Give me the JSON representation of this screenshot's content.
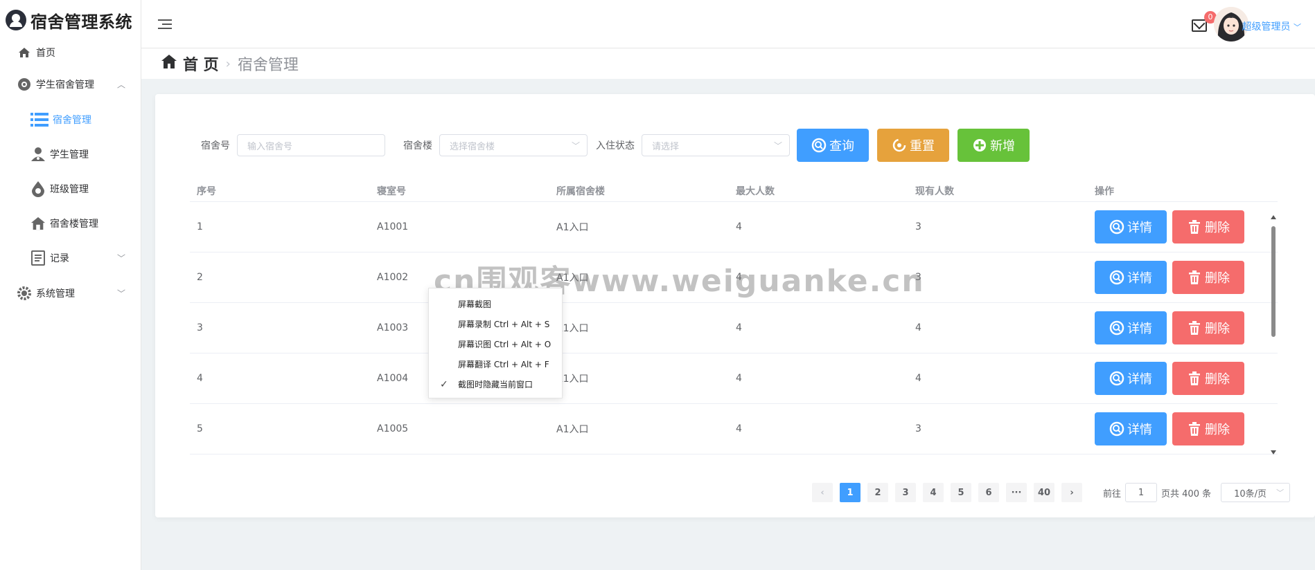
{
  "app": {
    "title": "宿舍管理系统"
  },
  "sidebar": {
    "items": [
      {
        "label": "首页",
        "icon": "home-icon"
      },
      {
        "label": "学生宿舍管理",
        "icon": "plus-circle-icon",
        "expanded": true
      },
      {
        "label": "宿舍管理",
        "icon": "list-icon",
        "active": true
      },
      {
        "label": "学生管理",
        "icon": "user-icon"
      },
      {
        "label": "班级管理",
        "icon": "drop-icon"
      },
      {
        "label": "宿舍楼管理",
        "icon": "building-icon"
      },
      {
        "label": "记录",
        "icon": "document-icon"
      },
      {
        "label": "系统管理",
        "icon": "gear-icon"
      }
    ]
  },
  "header": {
    "mail_badge": "0",
    "user_name": "超级管理员"
  },
  "breadcrumb": {
    "home": "首 页",
    "current": "宿舍管理"
  },
  "filter": {
    "dorm_no_label": "宿舍号",
    "dorm_no_placeholder": "输入宿舍号",
    "building_label": "宿舍楼",
    "building_placeholder": "选择宿舍楼",
    "status_label": "入住状态",
    "status_placeholder": "请选择",
    "search_btn": "查询",
    "reset_btn": "重置",
    "add_btn": "新增"
  },
  "table": {
    "columns": [
      "序号",
      "寝室号",
      "所属宿舍楼",
      "最大人数",
      "现有人数",
      "操作"
    ],
    "detail_btn": "详情",
    "delete_btn": "删除",
    "rows": [
      [
        "1",
        "A1001",
        "A1入口",
        "4",
        "3"
      ],
      [
        "2",
        "A1002",
        "A1入口",
        "4",
        "3"
      ],
      [
        "3",
        "A1003",
        "A1入口",
        "4",
        "4"
      ],
      [
        "4",
        "A1004",
        "A1入口",
        "4",
        "4"
      ],
      [
        "5",
        "A1005",
        "A1入口",
        "4",
        "3"
      ]
    ]
  },
  "pagination": {
    "pages": [
      "1",
      "2",
      "3",
      "4",
      "5",
      "6",
      "···",
      "40"
    ],
    "current": "1",
    "goto_label": "前往",
    "goto_value": "1",
    "total_label": "页共 400 条",
    "page_size": "10条/页"
  },
  "context_menu": {
    "items": [
      {
        "label": "屏幕截图",
        "checked": false
      },
      {
        "label": "屏幕录制 Ctrl + Alt + S",
        "checked": false
      },
      {
        "label": "屏幕识图 Ctrl + Alt + O",
        "checked": false
      },
      {
        "label": "屏幕翻译 Ctrl + Alt + F",
        "checked": false
      },
      {
        "label": "截图时隐藏当前窗口",
        "checked": true
      }
    ]
  },
  "watermark": "cn围观客www.weiguanke.cn",
  "colors": {
    "primary": "#409eff",
    "warning": "#e6a23c",
    "success": "#67c23a",
    "danger": "#f56c6c"
  }
}
